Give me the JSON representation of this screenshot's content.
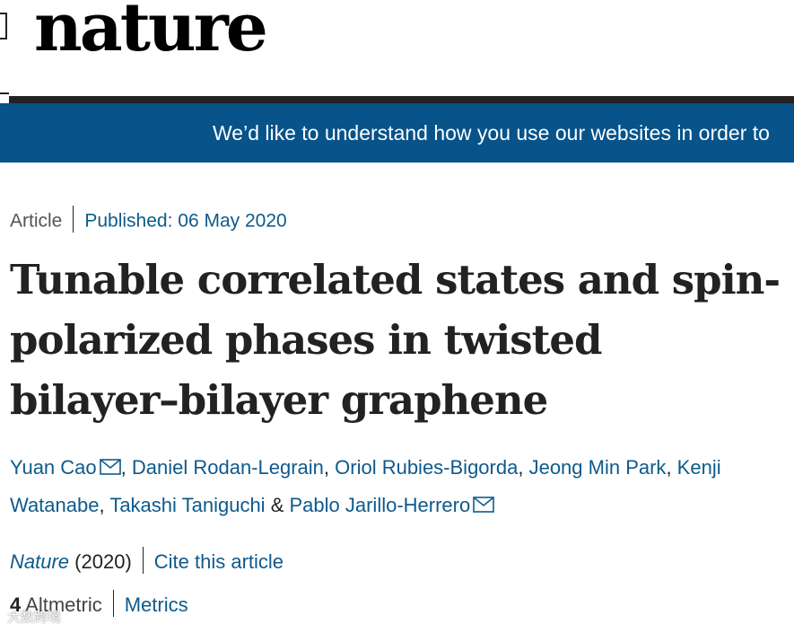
{
  "header": {
    "logo": "nature"
  },
  "banner": {
    "text": "We’d like to understand how you use our websites in order to"
  },
  "article": {
    "type": "Article",
    "published_label": "Published:",
    "published_date": "06 May 2020",
    "title": "Tunable correlated states and spin-polarized phases in twisted bilayer–bilayer graphene",
    "authors": [
      {
        "name": "Yuan Cao",
        "email": true
      },
      {
        "name": "Daniel Rodan-Legrain",
        "email": false
      },
      {
        "name": "Oriol Rubies-Bigorda",
        "email": false
      },
      {
        "name": "Jeong Min Park",
        "email": false
      },
      {
        "name": "Kenji Watanabe",
        "email": false
      },
      {
        "name": "Takashi Taniguchi",
        "email": false
      },
      {
        "name": "Pablo Jarillo-Herrero",
        "email": true
      }
    ],
    "journal": "Nature",
    "year": "(2020)",
    "cite_label": "Cite this article",
    "altmetric_count": "4",
    "altmetric_label": "Altmetric",
    "metrics_label": "Metrics"
  },
  "watermark": "大数跨境",
  "colors": {
    "banner_bg": "#07538a",
    "link": "#0e5a8c",
    "text": "#222222"
  }
}
